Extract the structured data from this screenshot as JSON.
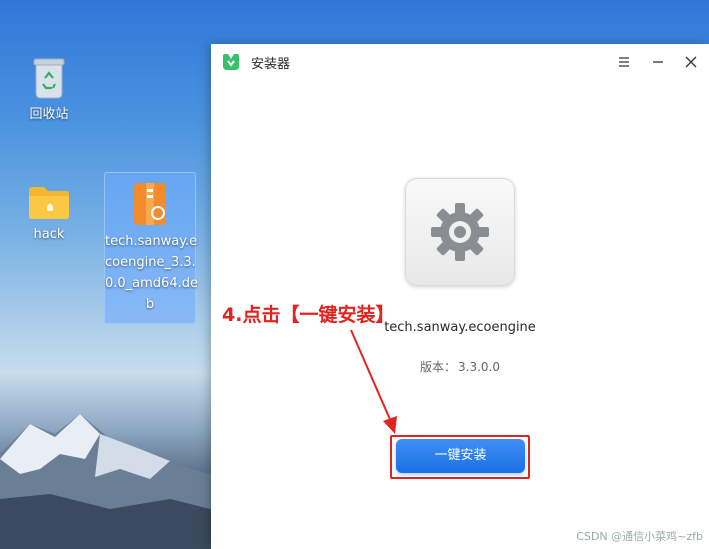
{
  "desktop": {
    "items": [
      {
        "label": "回收站",
        "icon": "trash-icon"
      },
      {
        "label": "hack",
        "icon": "folder-icon"
      },
      {
        "label_lines": [
          "tech.sanway.e",
          "coengine_3.3.",
          "0.0_amd64.de",
          "b"
        ],
        "icon": "package-icon",
        "selected": true
      }
    ]
  },
  "window": {
    "title": "安装器",
    "app_icon": "installer-icon",
    "controls": {
      "menu": "menu-icon",
      "minimize": "minimize-icon",
      "close": "close-icon"
    },
    "package": {
      "icon": "gear-icon",
      "name": "tech.sanway.ecoengine",
      "version_label": "版本：",
      "version_value": "3.3.0.0"
    },
    "install_button": "一键安装"
  },
  "annotation": {
    "text": "4.点击【一键安装】",
    "color": "#e2241f"
  },
  "watermark": "CSDN @通信小菜鸡~zfb",
  "colors": {
    "accent": "#1b6fe3",
    "annotation": "#e2241f"
  }
}
